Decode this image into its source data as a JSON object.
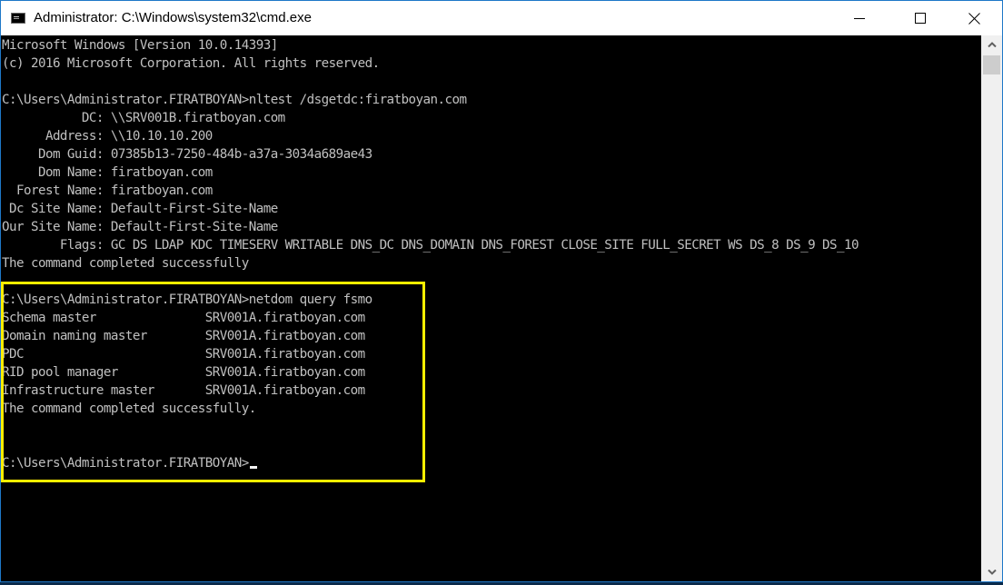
{
  "window": {
    "title": "Administrator: C:\\Windows\\system32\\cmd.exe",
    "buttons": {
      "minimize": "minimize-icon",
      "maximize": "maximize-icon",
      "close": "close-icon"
    }
  },
  "console": {
    "lines": [
      "Microsoft Windows [Version 10.0.14393]",
      "(c) 2016 Microsoft Corporation. All rights reserved.",
      "",
      "C:\\Users\\Administrator.FIRATBOYAN>nltest /dsgetdc:firatboyan.com",
      "           DC: \\\\SRV001B.firatboyan.com",
      "      Address: \\\\10.10.10.200",
      "     Dom Guid: 07385b13-7250-484b-a37a-3034a689ae43",
      "     Dom Name: firatboyan.com",
      "  Forest Name: firatboyan.com",
      " Dc Site Name: Default-First-Site-Name",
      "Our Site Name: Default-First-Site-Name",
      "        Flags: GC DS LDAP KDC TIMESERV WRITABLE DNS_DC DNS_DOMAIN DNS_FOREST CLOSE_SITE FULL_SECRET WS DS_8 DS_9 DS_10",
      "The command completed successfully",
      "",
      "C:\\Users\\Administrator.FIRATBOYAN>netdom query fsmo",
      "Schema master               SRV001A.firatboyan.com",
      "Domain naming master        SRV001A.firatboyan.com",
      "PDC                         SRV001A.firatboyan.com",
      "RID pool manager            SRV001A.firatboyan.com",
      "Infrastructure master       SRV001A.firatboyan.com",
      "The command completed successfully.",
      "",
      "",
      "C:\\Users\\Administrator.FIRATBOYAN>"
    ]
  },
  "colors": {
    "highlight": "#ffee00",
    "console_text": "#c0c0c0",
    "console_bg": "#000000",
    "window_border": "#1e78c8"
  }
}
